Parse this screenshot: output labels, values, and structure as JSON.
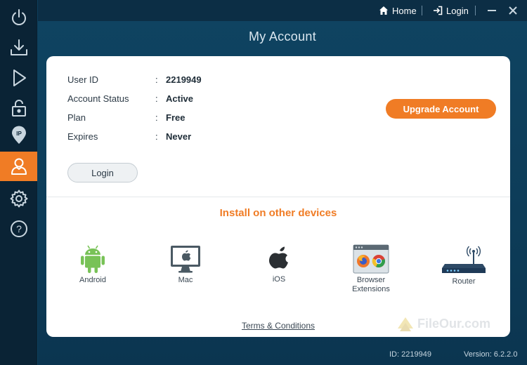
{
  "sidebar": {
    "items": [
      {
        "name": "power-icon"
      },
      {
        "name": "download-icon"
      },
      {
        "name": "play-icon"
      },
      {
        "name": "lock-icon"
      },
      {
        "name": "ip-location-icon",
        "badge": "IP"
      },
      {
        "name": "account-icon",
        "active": true
      },
      {
        "name": "gear-icon"
      },
      {
        "name": "help-icon",
        "glyph": "?"
      }
    ]
  },
  "topbar": {
    "home_label": "Home",
    "login_label": "Login"
  },
  "page": {
    "title": "My Account"
  },
  "account": {
    "rows": [
      {
        "label": "User ID",
        "colon": ":",
        "value": "2219949"
      },
      {
        "label": "Account Status",
        "colon": ":",
        "value": "Active"
      },
      {
        "label": "Plan",
        "colon": ":",
        "value": "Free"
      },
      {
        "label": "Expires",
        "colon": ":",
        "value": "Never"
      }
    ],
    "login_button": "Login",
    "upgrade_button": "Upgrade Account"
  },
  "install": {
    "title": "Install on other devices",
    "devices": [
      {
        "label": "Android"
      },
      {
        "label": "Mac"
      },
      {
        "label": "iOS"
      },
      {
        "label_line1": "Browser",
        "label_line2": "Extensions"
      },
      {
        "label": "Router"
      }
    ],
    "terms": "Terms & Conditions"
  },
  "watermark": "FileOur.com",
  "status": {
    "id_text": "ID:  2219949",
    "version_text": "Version:  6.2.2.0"
  },
  "colors": {
    "accent": "#f07c25",
    "sidebar_bg": "#0a2335",
    "main_bg": "#0e3f5c",
    "android_green": "#78c257",
    "mac_gray": "#4a5963"
  }
}
